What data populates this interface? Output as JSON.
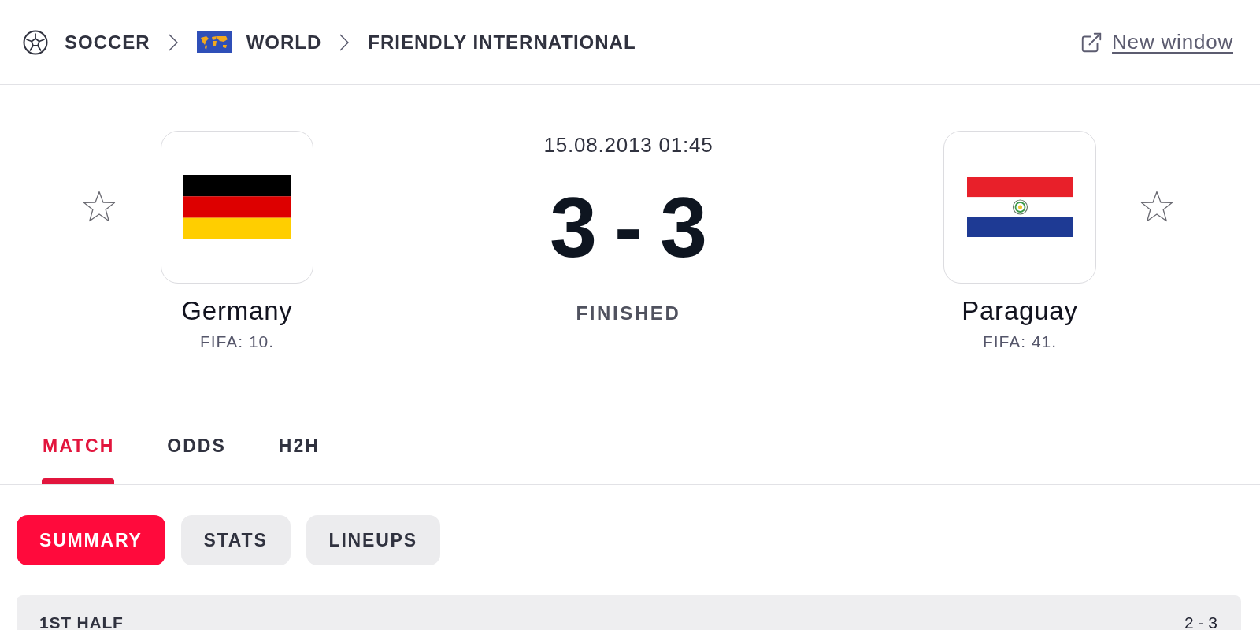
{
  "breadcrumb": [
    {
      "label": "SOCCER",
      "kind": "sport"
    },
    {
      "label": "WORLD",
      "kind": "region"
    },
    {
      "label": "FRIENDLY INTERNATIONAL",
      "kind": "competition"
    }
  ],
  "new_window_link": {
    "label": "New window"
  },
  "match": {
    "date": "15.08.2013 01:45",
    "home_score": "3",
    "separator": "-",
    "away_score": "3",
    "status": "FINISHED"
  },
  "teams": [
    {
      "name": "Germany",
      "rank": "FIFA: 10.",
      "kind": "germany",
      "favorite": false
    },
    {
      "name": "Paraguay",
      "rank": "FIFA: 41.",
      "kind": "paraguay",
      "favorite": false
    }
  ],
  "tabs": [
    {
      "label": "MATCH",
      "selected": true
    },
    {
      "label": "ODDS",
      "selected": false
    },
    {
      "label": "H2H",
      "selected": false
    }
  ],
  "subtabs": [
    {
      "label": "SUMMARY",
      "selected": true
    },
    {
      "label": "STATS",
      "selected": false
    },
    {
      "label": "LINEUPS",
      "selected": false
    }
  ],
  "periods": [
    {
      "label": "1ST HALF",
      "score": "2 - 3"
    }
  ]
}
